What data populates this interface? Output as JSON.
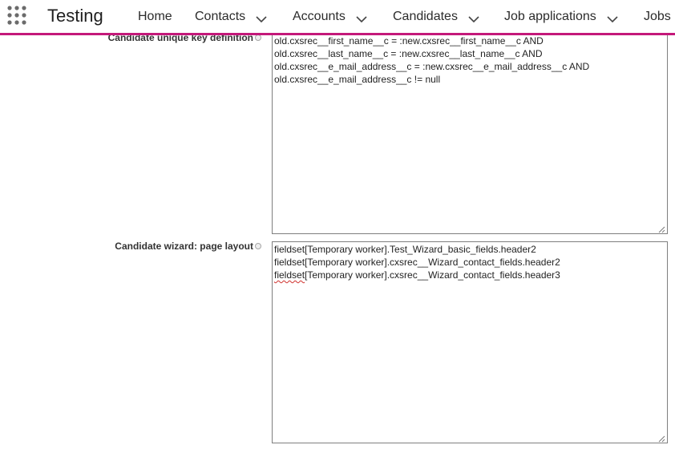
{
  "app": {
    "title": "Testing"
  },
  "nav": {
    "items": [
      {
        "label": "Home",
        "has_dropdown": false
      },
      {
        "label": "Contacts",
        "has_dropdown": true
      },
      {
        "label": "Accounts",
        "has_dropdown": true
      },
      {
        "label": "Candidates",
        "has_dropdown": true
      },
      {
        "label": "Job applications",
        "has_dropdown": true
      },
      {
        "label": "Jobs",
        "has_dropdown": false
      }
    ],
    "accent_color": "#c4197a"
  },
  "form": {
    "unique_key": {
      "label": "Candidate unique key definition",
      "lines": [
        "old.cxsrec__first_name__c = :new.cxsrec__first_name__c AND",
        "old.cxsrec__last_name__c = :new.cxsrec__last_name__c AND",
        "old.cxsrec__e_mail_address__c = :new.cxsrec__e_mail_address__c AND",
        "old.cxsrec__e_mail_address__c != null"
      ]
    },
    "wizard_layout": {
      "label": "Candidate wizard: page layout",
      "lines": [
        "fieldset[Temporary worker].Test_Wizard_basic_fields.header2",
        "fieldset[Temporary worker].cxsrec__Wizard_contact_fields.header2"
      ],
      "last_line_flagged": "fieldset",
      "last_line_rest": "[Temporary worker].cxsrec__Wizard_contact_fields.header3"
    }
  }
}
